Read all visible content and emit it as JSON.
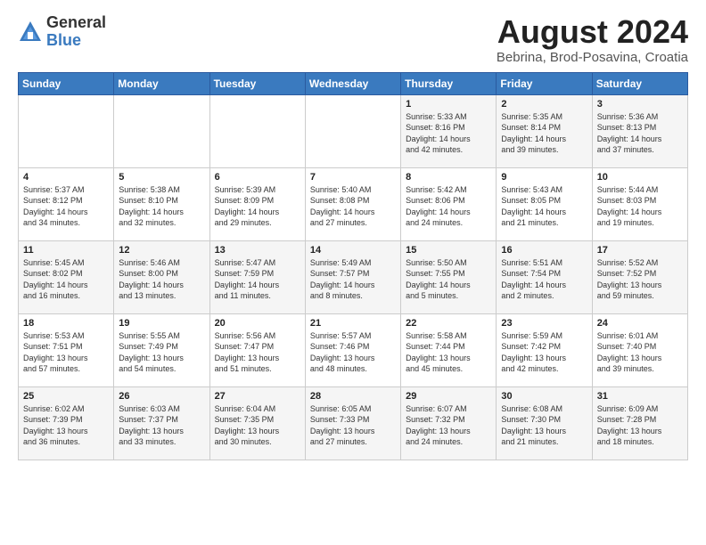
{
  "logo": {
    "general": "General",
    "blue": "Blue"
  },
  "title": "August 2024",
  "subtitle": "Bebrina, Brod-Posavina, Croatia",
  "days_header": [
    "Sunday",
    "Monday",
    "Tuesday",
    "Wednesday",
    "Thursday",
    "Friday",
    "Saturday"
  ],
  "weeks": [
    [
      {
        "day": "",
        "info": ""
      },
      {
        "day": "",
        "info": ""
      },
      {
        "day": "",
        "info": ""
      },
      {
        "day": "",
        "info": ""
      },
      {
        "day": "1",
        "info": "Sunrise: 5:33 AM\nSunset: 8:16 PM\nDaylight: 14 hours\nand 42 minutes."
      },
      {
        "day": "2",
        "info": "Sunrise: 5:35 AM\nSunset: 8:14 PM\nDaylight: 14 hours\nand 39 minutes."
      },
      {
        "day": "3",
        "info": "Sunrise: 5:36 AM\nSunset: 8:13 PM\nDaylight: 14 hours\nand 37 minutes."
      }
    ],
    [
      {
        "day": "4",
        "info": "Sunrise: 5:37 AM\nSunset: 8:12 PM\nDaylight: 14 hours\nand 34 minutes."
      },
      {
        "day": "5",
        "info": "Sunrise: 5:38 AM\nSunset: 8:10 PM\nDaylight: 14 hours\nand 32 minutes."
      },
      {
        "day": "6",
        "info": "Sunrise: 5:39 AM\nSunset: 8:09 PM\nDaylight: 14 hours\nand 29 minutes."
      },
      {
        "day": "7",
        "info": "Sunrise: 5:40 AM\nSunset: 8:08 PM\nDaylight: 14 hours\nand 27 minutes."
      },
      {
        "day": "8",
        "info": "Sunrise: 5:42 AM\nSunset: 8:06 PM\nDaylight: 14 hours\nand 24 minutes."
      },
      {
        "day": "9",
        "info": "Sunrise: 5:43 AM\nSunset: 8:05 PM\nDaylight: 14 hours\nand 21 minutes."
      },
      {
        "day": "10",
        "info": "Sunrise: 5:44 AM\nSunset: 8:03 PM\nDaylight: 14 hours\nand 19 minutes."
      }
    ],
    [
      {
        "day": "11",
        "info": "Sunrise: 5:45 AM\nSunset: 8:02 PM\nDaylight: 14 hours\nand 16 minutes."
      },
      {
        "day": "12",
        "info": "Sunrise: 5:46 AM\nSunset: 8:00 PM\nDaylight: 14 hours\nand 13 minutes."
      },
      {
        "day": "13",
        "info": "Sunrise: 5:47 AM\nSunset: 7:59 PM\nDaylight: 14 hours\nand 11 minutes."
      },
      {
        "day": "14",
        "info": "Sunrise: 5:49 AM\nSunset: 7:57 PM\nDaylight: 14 hours\nand 8 minutes."
      },
      {
        "day": "15",
        "info": "Sunrise: 5:50 AM\nSunset: 7:55 PM\nDaylight: 14 hours\nand 5 minutes."
      },
      {
        "day": "16",
        "info": "Sunrise: 5:51 AM\nSunset: 7:54 PM\nDaylight: 14 hours\nand 2 minutes."
      },
      {
        "day": "17",
        "info": "Sunrise: 5:52 AM\nSunset: 7:52 PM\nDaylight: 13 hours\nand 59 minutes."
      }
    ],
    [
      {
        "day": "18",
        "info": "Sunrise: 5:53 AM\nSunset: 7:51 PM\nDaylight: 13 hours\nand 57 minutes."
      },
      {
        "day": "19",
        "info": "Sunrise: 5:55 AM\nSunset: 7:49 PM\nDaylight: 13 hours\nand 54 minutes."
      },
      {
        "day": "20",
        "info": "Sunrise: 5:56 AM\nSunset: 7:47 PM\nDaylight: 13 hours\nand 51 minutes."
      },
      {
        "day": "21",
        "info": "Sunrise: 5:57 AM\nSunset: 7:46 PM\nDaylight: 13 hours\nand 48 minutes."
      },
      {
        "day": "22",
        "info": "Sunrise: 5:58 AM\nSunset: 7:44 PM\nDaylight: 13 hours\nand 45 minutes."
      },
      {
        "day": "23",
        "info": "Sunrise: 5:59 AM\nSunset: 7:42 PM\nDaylight: 13 hours\nand 42 minutes."
      },
      {
        "day": "24",
        "info": "Sunrise: 6:01 AM\nSunset: 7:40 PM\nDaylight: 13 hours\nand 39 minutes."
      }
    ],
    [
      {
        "day": "25",
        "info": "Sunrise: 6:02 AM\nSunset: 7:39 PM\nDaylight: 13 hours\nand 36 minutes."
      },
      {
        "day": "26",
        "info": "Sunrise: 6:03 AM\nSunset: 7:37 PM\nDaylight: 13 hours\nand 33 minutes."
      },
      {
        "day": "27",
        "info": "Sunrise: 6:04 AM\nSunset: 7:35 PM\nDaylight: 13 hours\nand 30 minutes."
      },
      {
        "day": "28",
        "info": "Sunrise: 6:05 AM\nSunset: 7:33 PM\nDaylight: 13 hours\nand 27 minutes."
      },
      {
        "day": "29",
        "info": "Sunrise: 6:07 AM\nSunset: 7:32 PM\nDaylight: 13 hours\nand 24 minutes."
      },
      {
        "day": "30",
        "info": "Sunrise: 6:08 AM\nSunset: 7:30 PM\nDaylight: 13 hours\nand 21 minutes."
      },
      {
        "day": "31",
        "info": "Sunrise: 6:09 AM\nSunset: 7:28 PM\nDaylight: 13 hours\nand 18 minutes."
      }
    ]
  ]
}
